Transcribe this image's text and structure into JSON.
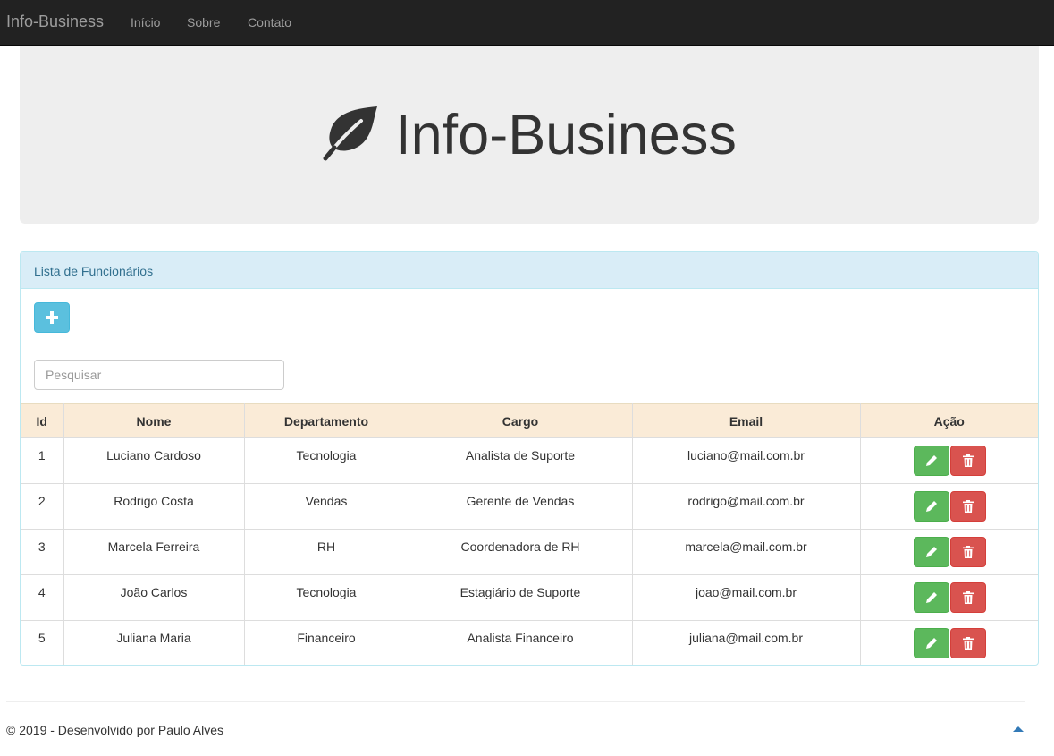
{
  "navbar": {
    "brand": "Info-Business",
    "links": [
      {
        "label": "Início"
      },
      {
        "label": "Sobre"
      },
      {
        "label": "Contato"
      }
    ]
  },
  "hero": {
    "icon": "leaf-icon",
    "title": "Info-Business"
  },
  "panel": {
    "heading": "Lista de Funcionários",
    "add_button_icon": "plus-icon",
    "search_placeholder": "Pesquisar",
    "search_value": ""
  },
  "table": {
    "columns": [
      "Id",
      "Nome",
      "Departamento",
      "Cargo",
      "Email",
      "Ação"
    ],
    "rows": [
      {
        "id": "1",
        "nome": "Luciano Cardoso",
        "departamento": "Tecnologia",
        "cargo": "Analista de Suporte",
        "email": "luciano@mail.com.br"
      },
      {
        "id": "2",
        "nome": "Rodrigo Costa",
        "departamento": "Vendas",
        "cargo": "Gerente de Vendas",
        "email": "rodrigo@mail.com.br"
      },
      {
        "id": "3",
        "nome": "Marcela Ferreira",
        "departamento": "RH",
        "cargo": "Coordenadora de RH",
        "email": "marcela@mail.com.br"
      },
      {
        "id": "4",
        "nome": "João Carlos",
        "departamento": "Tecnologia",
        "cargo": "Estagiário de Suporte",
        "email": "joao@mail.com.br"
      },
      {
        "id": "5",
        "nome": "Juliana Maria",
        "departamento": "Financeiro",
        "cargo": "Analista Financeiro",
        "email": "juliana@mail.com.br"
      }
    ],
    "row_actions": {
      "edit_icon": "pencil-icon",
      "delete_icon": "trash-icon"
    }
  },
  "footer": {
    "text": "© 2019 - Desenvolvido por Paulo Alves",
    "back_to_top_icon": "triangle-up-icon"
  },
  "colors": {
    "navbar_bg": "#222222",
    "panel_heading_bg": "#d9edf7",
    "table_header_bg": "#faebd7",
    "info_button": "#5bc0de",
    "success_button": "#5cb85c",
    "danger_button": "#d9534f",
    "link": "#337ab7"
  }
}
